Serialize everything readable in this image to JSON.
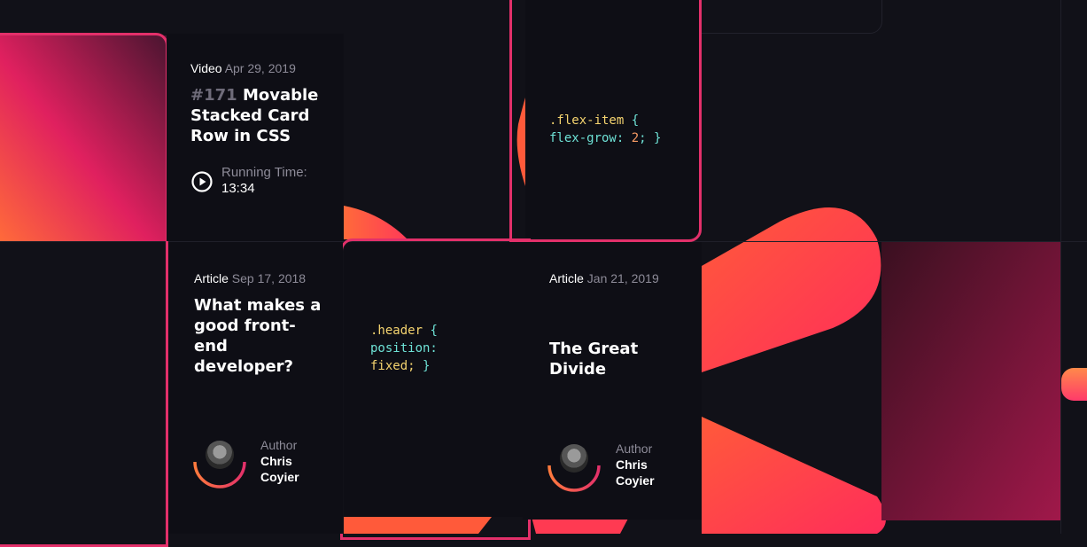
{
  "cards": {
    "video": {
      "kind": "Video",
      "date": "Apr 29, 2019",
      "number": "#171",
      "title_line1": "Movable",
      "title_line2": "Stacked Card",
      "title_line3": "Row in CSS",
      "running_label": "Running Time:",
      "running_time": "13:34"
    },
    "article1": {
      "kind": "Article",
      "date": "Sep 17, 2018",
      "title_line1": "What makes a",
      "title_line2": "good front-",
      "title_line3": "end",
      "title_line4": "developer?",
      "author_label": "Author",
      "author_first": "Chris",
      "author_last": "Coyier"
    },
    "article2": {
      "kind": "Article",
      "date": "Jan 21, 2019",
      "title_line1": "The Great",
      "title_line2": "Divide",
      "author_label": "Author",
      "author_first": "Chris",
      "author_last": "Coyier"
    },
    "code1": {
      "selector": ".flex-item",
      "open": "{",
      "property": "flex-grow:",
      "value": "2",
      "close": "; }"
    },
    "code2": {
      "selector": ".header",
      "open": "{",
      "property": "position:",
      "value": "fixed;",
      "close": "}"
    }
  },
  "colors": {
    "accent_pink": "#e3306a",
    "accent_orange": "#ff7a3d",
    "background": "#111118"
  },
  "icons": {
    "play": "play-circle-icon",
    "scroll": "scroll-thumb"
  }
}
